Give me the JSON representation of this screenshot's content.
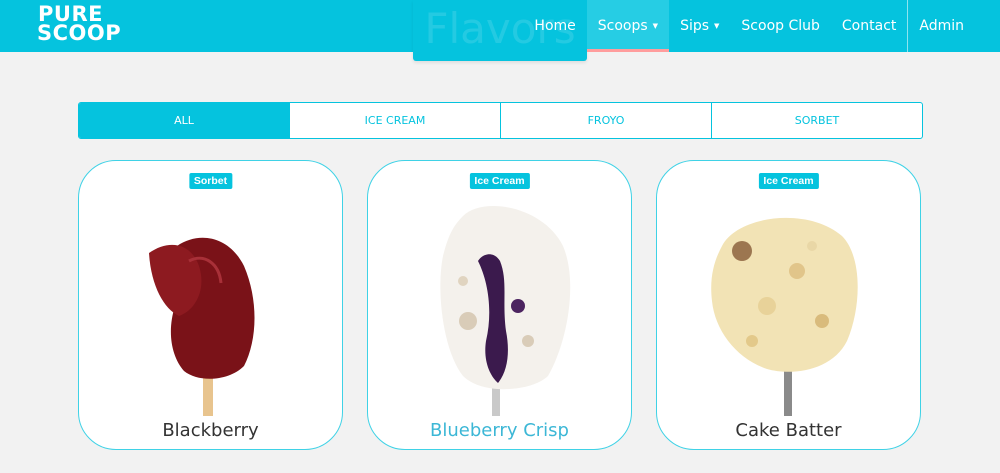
{
  "nav": {
    "logo_line1": "PURE",
    "logo_line2": "SCOOP",
    "hero_title": "Flavors",
    "items": [
      {
        "label": "Home",
        "dropdown": false,
        "active": false
      },
      {
        "label": "Scoops",
        "dropdown": true,
        "active": true
      },
      {
        "label": "Sips",
        "dropdown": true,
        "active": false
      },
      {
        "label": "Scoop Club",
        "dropdown": false,
        "active": false
      },
      {
        "label": "Contact",
        "dropdown": false,
        "active": false
      },
      {
        "label": "Admin",
        "dropdown": false,
        "active": false
      }
    ]
  },
  "filters": [
    {
      "label": "ALL",
      "active": true
    },
    {
      "label": "ICE CREAM",
      "active": false
    },
    {
      "label": "FROYO",
      "active": false
    },
    {
      "label": "SORBET",
      "active": false
    }
  ],
  "cards": [
    {
      "badge": "Sorbet",
      "name": "Blackberry",
      "image": "blackberry-popsicle"
    },
    {
      "badge": "Ice Cream",
      "name": "Blueberry Crisp",
      "image": "blueberry-crisp-popsicle"
    },
    {
      "badge": "Ice Cream",
      "name": "Cake Batter",
      "image": "cake-batter-scoop"
    }
  ],
  "colors": {
    "accent": "#05c3de",
    "active_underline": "#ff9d9d",
    "hover_name": "#3cb7d6"
  }
}
